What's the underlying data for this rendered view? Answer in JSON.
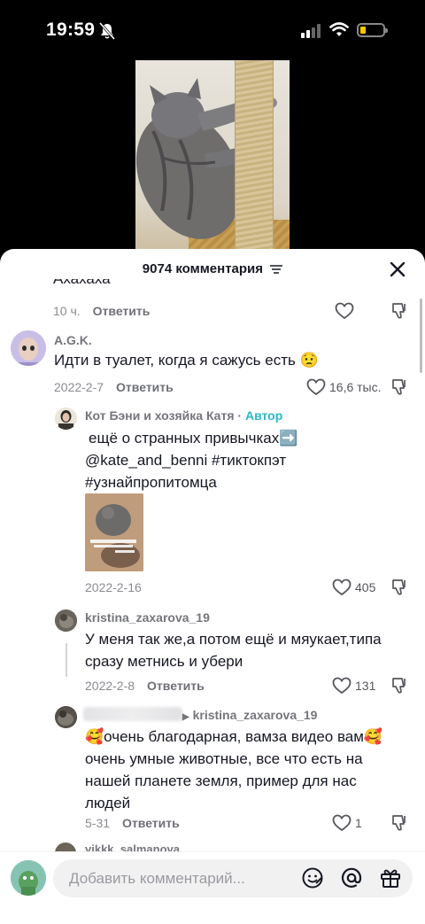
{
  "status": {
    "time": "19:59"
  },
  "sheet": {
    "title": "9074 комментария"
  },
  "comments": [
    {
      "truncated_text": "Ахахаха",
      "time": "10 ч.",
      "reply": "Ответить"
    },
    {
      "user": "A.G.K.",
      "text": "Идти в туалет, когда я сажусь есть 😟",
      "date": "2022-2-7",
      "reply": "Ответить",
      "likes": "16,6 тыс."
    }
  ],
  "replies": [
    {
      "user": "Кот Бэни и хозяйка Катя",
      "separator": "·",
      "author_label": "Автор",
      "text_line1": "ещё о странных привычках➡️",
      "text_line2": "@kate_and_benni #тиктокпэт",
      "text_line3": "#узнайпропитомца",
      "date": "2022-2-16",
      "likes": "405"
    },
    {
      "user": "kristina_zaxarova_19",
      "text_line1": "У меня так же,а потом ещё и мяукает,типа",
      "text_line2": "сразу метнись и убери",
      "date": "2022-2-8",
      "reply": "Ответить",
      "likes": "131"
    },
    {
      "reply_to": "kristina_zaxarova_19",
      "text_line1": "🥰очень благодарная, вамза видео вам🥰",
      "text_line2": "очень умные животные, все что есть на",
      "text_line3": "нашей планете земля, пример для нас",
      "text_line4": "людей",
      "date": "5-31",
      "reply": "Ответить",
      "likes": "1"
    },
    {
      "user": "vikkk_salmanova"
    }
  ],
  "input": {
    "placeholder": "Добавить комментарий..."
  },
  "icons": {
    "status": [
      "bell-slash-icon",
      "signal-icon",
      "wifi-icon",
      "battery-icon"
    ],
    "sheet": [
      "filter-icon",
      "close-icon",
      "heart-icon",
      "dislike-icon"
    ],
    "input": [
      "emoji-icon",
      "mention-icon",
      "gift-icon"
    ]
  },
  "colors": {
    "author_tag": "#2bb8c6",
    "battery": "#f7c600",
    "text": "#161823",
    "muted": "#8a8b91"
  }
}
